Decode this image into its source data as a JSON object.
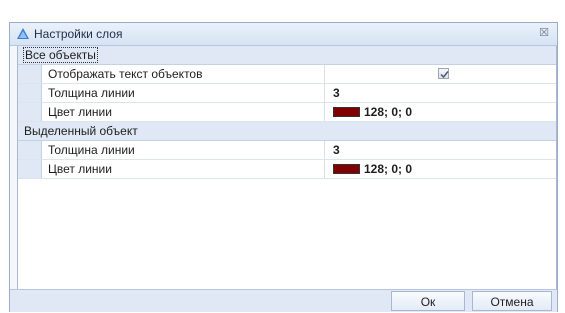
{
  "window": {
    "title": "Настройки слоя",
    "close_glyph": "☒"
  },
  "groups": [
    {
      "label": "Все объекты",
      "rows": [
        {
          "name": "Отображать текст объектов",
          "type": "checkbox",
          "checked": true
        },
        {
          "name": "Толщина линии",
          "type": "text",
          "value": "3"
        },
        {
          "name": "Цвет линии",
          "type": "color",
          "value": "128; 0; 0",
          "color": "#800000"
        }
      ]
    },
    {
      "label": "Выделенный объект",
      "rows": [
        {
          "name": "Толщина линии",
          "type": "text",
          "value": "3"
        },
        {
          "name": "Цвет линии",
          "type": "color",
          "value": "128; 0; 0",
          "color": "#800000"
        }
      ]
    }
  ],
  "buttons": {
    "ok": "Ок",
    "cancel": "Отмена"
  },
  "colors": {
    "accent": "#dfe8f4",
    "swatch": "#800000"
  }
}
